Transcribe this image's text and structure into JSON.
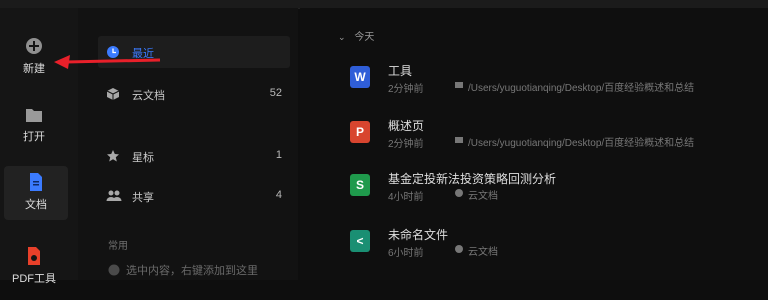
{
  "leftnav": {
    "new_label": "新建",
    "open_label": "打开",
    "docs_label": "文档",
    "pdf_label": "PDF工具"
  },
  "sidebar": {
    "items": [
      {
        "label": "最近",
        "count": ""
      },
      {
        "label": "云文档",
        "count": "52"
      },
      {
        "label": "星标",
        "count": "1"
      },
      {
        "label": "共享",
        "count": "4"
      }
    ],
    "section_label": "常用",
    "hint_text": "选中内容，右键添加到这里"
  },
  "main": {
    "group_label": "今天",
    "files": [
      {
        "name": "工具",
        "time": "2分钟前",
        "location": "/Users/yuguotianqing/Desktop/百度经验概述和总结",
        "type_icon": "writer-icon",
        "color": "#2f5ed8",
        "letter": "W"
      },
      {
        "name": "概述页",
        "time": "2分钟前",
        "location": "/Users/yuguotianqing/Desktop/百度经验概述和总结",
        "type_icon": "presentation-icon",
        "color": "#d8452f",
        "letter": "P"
      },
      {
        "name": "基金定投新法投资策略回测分析",
        "time": "4小时前",
        "location": "云文档",
        "type_icon": "spreadsheet-icon",
        "color": "#1f9a4c",
        "letter": "S"
      },
      {
        "name": "未命名文件",
        "time": "6小时前",
        "location": "云文档",
        "type_icon": "mindmap-icon",
        "color": "#1a8f73",
        "letter": "<"
      }
    ]
  },
  "colors": {
    "accent_blue": "#3b7bff",
    "arrow_red": "#e8202a"
  }
}
